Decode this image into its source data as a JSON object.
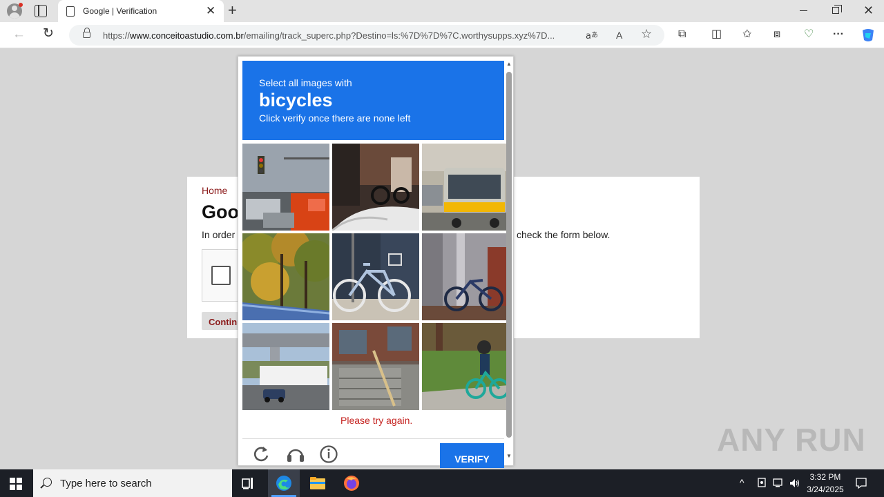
{
  "browser": {
    "tab_title": "Google | Verification",
    "tab_close": "✕",
    "new_tab": "+",
    "window_close": "✕",
    "url_prefix": "https://",
    "url_host": "www.conceitoastudio.com.br",
    "url_rest": "/emailing/track_superc.php?Destino=ls:%7D%7D%7C.worthysupps.xyz%7D...",
    "back_glyph": "←",
    "refresh_glyph": "↻",
    "read_aloud_glyph": "A",
    "favorite_glyph": "☆",
    "extensions_glyph": "⧉",
    "split_glyph": "◫",
    "favorites_glyph": "✩",
    "collections_glyph": "⧈",
    "browser_essentials_glyph": "♡",
    "more_glyph": "···"
  },
  "page": {
    "home_link": "Home",
    "title": "Google | Verification",
    "intro_start": "In order to continue, please",
    "intro_end": "check the form below.",
    "continue_label": "Continue"
  },
  "captcha": {
    "instruction": "Select all images with",
    "keyword": "bicycles",
    "subtext": "Click verify once there are none left",
    "error": "Please try again.",
    "verify_label": "VERIFY",
    "scroll_up": "▲",
    "scroll_down": "▼"
  },
  "taskbar": {
    "search_placeholder": "Type here to search",
    "time": "3:32 PM",
    "date": "3/24/2025",
    "tray_chevron": "^"
  },
  "watermark": "ANY RUN",
  "colors": {
    "captcha_blue": "#1a73e8",
    "error_red": "#c5221f",
    "link_maroon": "#8b1a1a"
  }
}
